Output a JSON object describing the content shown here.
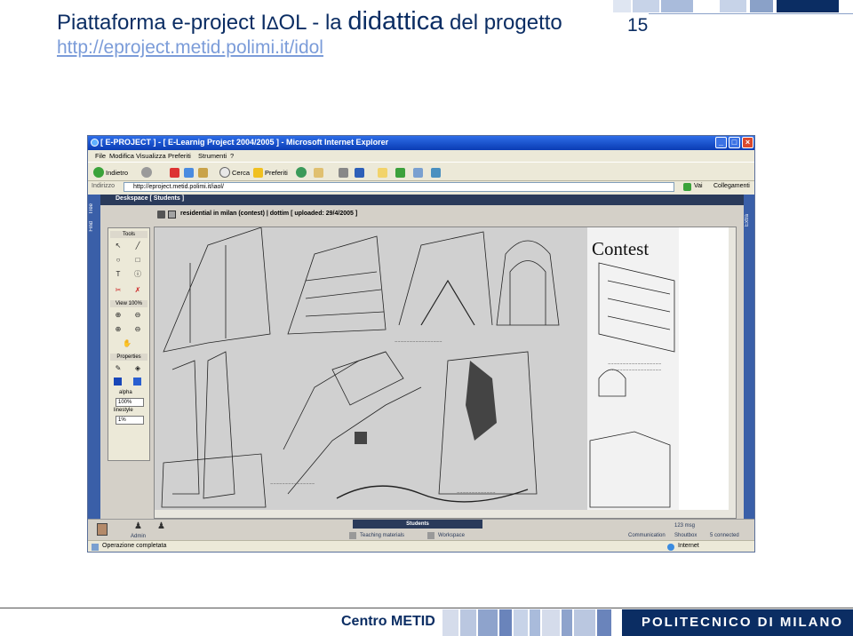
{
  "slide": {
    "title_part1": "Piattaforma e-project I",
    "title_delta": "∆",
    "title_part2": "OL - la ",
    "title_big": "didattica",
    "title_part3": " del progetto",
    "number": "15",
    "url": "http://eproject.metid.polimi.it/idol"
  },
  "browser": {
    "window_title": "[ E-PROJECT ] - [ E-Learnig Project 2004/2005 ] - Microsoft Internet Explorer",
    "menu": [
      "File",
      "Modifica",
      "Visualizza",
      "Preferiti",
      "Strumenti",
      "?"
    ],
    "toolbar": {
      "back": "Indietro",
      "search": "Cerca",
      "favorites": "Preferiti"
    },
    "address_label": "Indirizzo",
    "address": "http://eproject.metid.polimi.it/iaol/",
    "go": "Vai",
    "links": "Collegamenti",
    "status": "Operazione completata",
    "zone": "Internet"
  },
  "app": {
    "left_tabs": [
      "Tree",
      "Find"
    ],
    "right_tab": "Extra",
    "deskspace": "Deskspace [ Students ]",
    "resource": "residential in milan (contest) | dottim [ uploaded: 29/4/2005 ]",
    "tools_panel": {
      "tools_header": "Tools",
      "view_header": "View",
      "view_zoom": "100%",
      "properties_header": "Properties",
      "alpha_label": "alpha",
      "alpha_value": "100%",
      "linestyle_label": "linestyle",
      "linestyle_value": "1%"
    },
    "sketch_title": "Contest",
    "bottom": {
      "admin": "Admin",
      "students": "Students",
      "teaching": "Teaching materials",
      "workspace": "Workspace",
      "communication": "Communication",
      "shoutbox": "Shoutbox",
      "msg_count": "123 msg",
      "connected": "5 connected"
    }
  },
  "footer": {
    "centro": "Centro METID",
    "polimi": "POLITECNICO DI MILANO"
  },
  "colors": {
    "title_blue": "#0b2d63",
    "url_blue": "#7b9cd9",
    "xp_blue": "#0a3cb4",
    "panel_blue": "#3a5fa8"
  }
}
